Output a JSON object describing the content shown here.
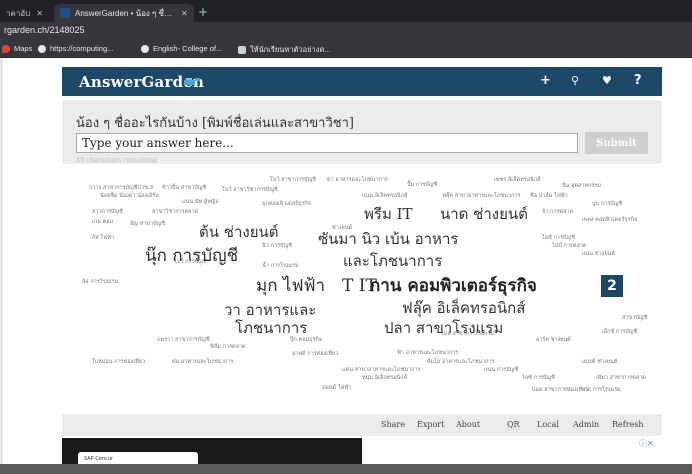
{
  "browser": {
    "tabs": [
      {
        "label": "าคาอับ"
      },
      {
        "label": "AnswerGarden • น้อง ๆ ชื่ออะไรกันบ"
      }
    ],
    "url": "rgarden.ch/2148025",
    "bookmarks": [
      {
        "label": "Maps"
      },
      {
        "label": "https://computing..."
      },
      {
        "label": "English- College of..."
      },
      {
        "label": "ให้นักเรียนหาตัวอย่างค..."
      }
    ]
  },
  "header": {
    "logo": "AnswerGarden",
    "brand_color": "#1d4767"
  },
  "question": {
    "title": "น้อง ๆ ชื่ออะไรกันบ้าง [พิมพ์ชื่อเล่นและสาขาวิชา]",
    "placeholder": "Type your answer here...",
    "submit_label": "Submit",
    "chars_remaining": "40 characters remaining"
  },
  "cloud": {
    "big": [
      "พรีม IT",
      "นาด ช่างยนต์",
      "ต้น ช่างยนต์",
      "ซันมา นิว เบ้น อาหาร",
      "นุ๊ก การบัญชี",
      "และโภชนาการ",
      "มุก ไฟฟ้า",
      "T IT",
      "กาน คอมพิวเตอร์ธุรกิจ",
      "วา อาหารและ",
      "ฟลุ๊ค อิเล็คทรอนิกส์",
      "โภชนาการ",
      "ปลา สาขาโรงแรม"
    ],
    "badge": "2",
    "small": [
      "โบว์ สาขาการบัญชี",
      "ดา อาหารและโภชนาการ",
      "เพชร อิเล็คทรอนิกส์",
      "กวาง สาขาการบัญชีปวช.3",
      "ข้าวปั้น สาขาบัญชี",
      "โบว์ สาขาวิชาการบัญชี",
      "นิ่ม อุตสาหกรรม",
      "ปั๊ม การบัญชี",
      "แนน อิเล็คทรอนิกส์",
      "ฟลุ๊ค สาขาอาหารและโภชนาการ",
      "ชื่อ ปาล์ม ไฟฟ้า",
      "น้อยชื่อ น้องดา น้องเอิร์น",
      "แนน นัท ผู้หญิง",
      "มุกคอมพิวเตอร์ธุรกิจ",
      "บูม การบัญชี",
      "สาวการบัญชี",
      "สาขาวิชาการตลาด",
      "จ้า การตลาด",
      "เพลง คอมพิวเตอร์ธุรกิจ",
      "เกม คอม",
      "อัญ สาขาบัญชี",
      "กัส ไฟฟ้า",
      "ไอซ์ การบัญชี",
      "นิว การบัญชี",
      "ช่างยนต์",
      "ไปป์ การตลาด",
      "แนน ช่างยนต์",
      "น้ำ การโรงแรม",
      "สาขาบัญชี",
      "อ้อ การโรงแรม",
      "โบว์ การบัญชี",
      "ฟิล์ม การตลาด",
      "ใบหม่อน การท่องเที่ยว",
      "ฝน อาหารและโภชนาการ",
      "ส้มโอ อาหารและโภชนาการ",
      "แนน การบัญชี",
      "ฟ้า อาหารและโภชนาการ",
      "ไอซ์ การบัญชี",
      "ปอนด์ ไฟฟ้า",
      "มายด์ การท่องเที่ยว",
      "เพียว สาขาการตลาด",
      "แบงค์ ช่างยนต์",
      "เอ็กซ์ การบัญชี",
      "แคน สาขาอาหารและโภชนาการ",
      "แพรวา สาขาการบัญชี",
      "ปุ๊ก คอมธุรกิจ",
      "เบส สาขาการโรงแรม",
      "หนุ่ม อิเล็กทรอนิกส์",
      "เกม การโรงแรม",
      "แอม สาขาการท่องเที่ยว",
      "อาร์ต ช่างยนต์"
    ]
  },
  "actions": [
    {
      "label": "Share"
    },
    {
      "label": "Export"
    },
    {
      "label": "About"
    },
    {
      "label": "QR"
    },
    {
      "label": "Local"
    },
    {
      "label": "Admin"
    },
    {
      "label": "Refresh"
    }
  ],
  "ad": {
    "card_text": "SAP Concur"
  }
}
